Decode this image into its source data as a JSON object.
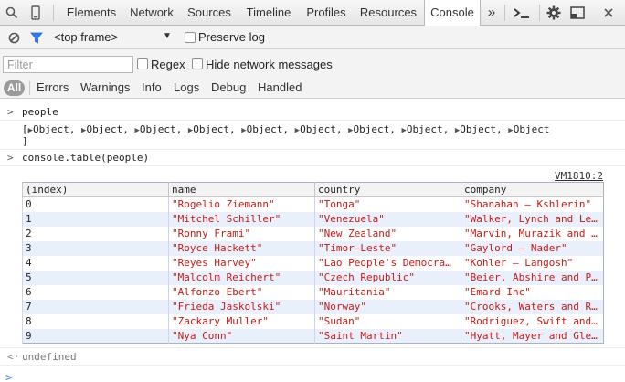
{
  "toolbar": {
    "tabs": [
      "Elements",
      "Network",
      "Sources",
      "Timeline",
      "Profiles",
      "Resources",
      "Console"
    ],
    "active_tab": "Console",
    "overflow_label": "»",
    "icons": [
      "search-icon",
      "device-mode-icon",
      "drawer-toggle-icon",
      "settings-gear-icon",
      "undock-icon",
      "close-icon"
    ]
  },
  "context_bar": {
    "frame_select": "<top frame>",
    "preserve_log_label": "Preserve log"
  },
  "filter_bar": {
    "filter_placeholder": "Filter",
    "regex_label": "Regex",
    "hide_network_label": "Hide network messages"
  },
  "levels": [
    "All",
    "Errors",
    "Warnings",
    "Info",
    "Logs",
    "Debug",
    "Handled"
  ],
  "console": {
    "cmd1": "people",
    "result1_open": "[",
    "result1_item": "Object,",
    "result1_last": "Object",
    "result1_count": 10,
    "result1_close": "]",
    "cmd2": "console.table(people)",
    "source_link": "VM1810:2",
    "table": {
      "headers": [
        "(index)",
        "name",
        "country",
        "company"
      ],
      "rows": [
        [
          "0",
          "\"Rogelio Ziemann\"",
          "\"Tonga\"",
          "\"Shanahan – Kshlerin\""
        ],
        [
          "1",
          "\"Mitchel Schiller\"",
          "\"Venezuela\"",
          "\"Walker, Lynch and Le…"
        ],
        [
          "2",
          "\"Ronny Frami\"",
          "\"New Zealand\"",
          "\"Marvin, Murazik and …"
        ],
        [
          "3",
          "\"Royce Hackett\"",
          "\"Timor–Leste\"",
          "\"Gaylord – Nader\""
        ],
        [
          "4",
          "\"Reyes Harvey\"",
          "\"Lao People's Democra…",
          "\"Kohler – Langosh\""
        ],
        [
          "5",
          "\"Malcolm Reichert\"",
          "\"Czech Republic\"",
          "\"Beier, Abshire and P…"
        ],
        [
          "6",
          "\"Alfonzo Ebert\"",
          "\"Mauritania\"",
          "\"Emard Inc\""
        ],
        [
          "7",
          "\"Frieda Jaskolski\"",
          "\"Norway\"",
          "\"Crooks, Waters and R…"
        ],
        [
          "8",
          "\"Zackary Muller\"",
          "\"Sudan\"",
          "\"Rodriguez, Swift and…"
        ],
        [
          "9",
          "\"Nya Conn\"",
          "\"Saint Martin\"",
          "\"Hyatt, Mayer and Gle…"
        ]
      ]
    },
    "return_value": "undefined"
  }
}
